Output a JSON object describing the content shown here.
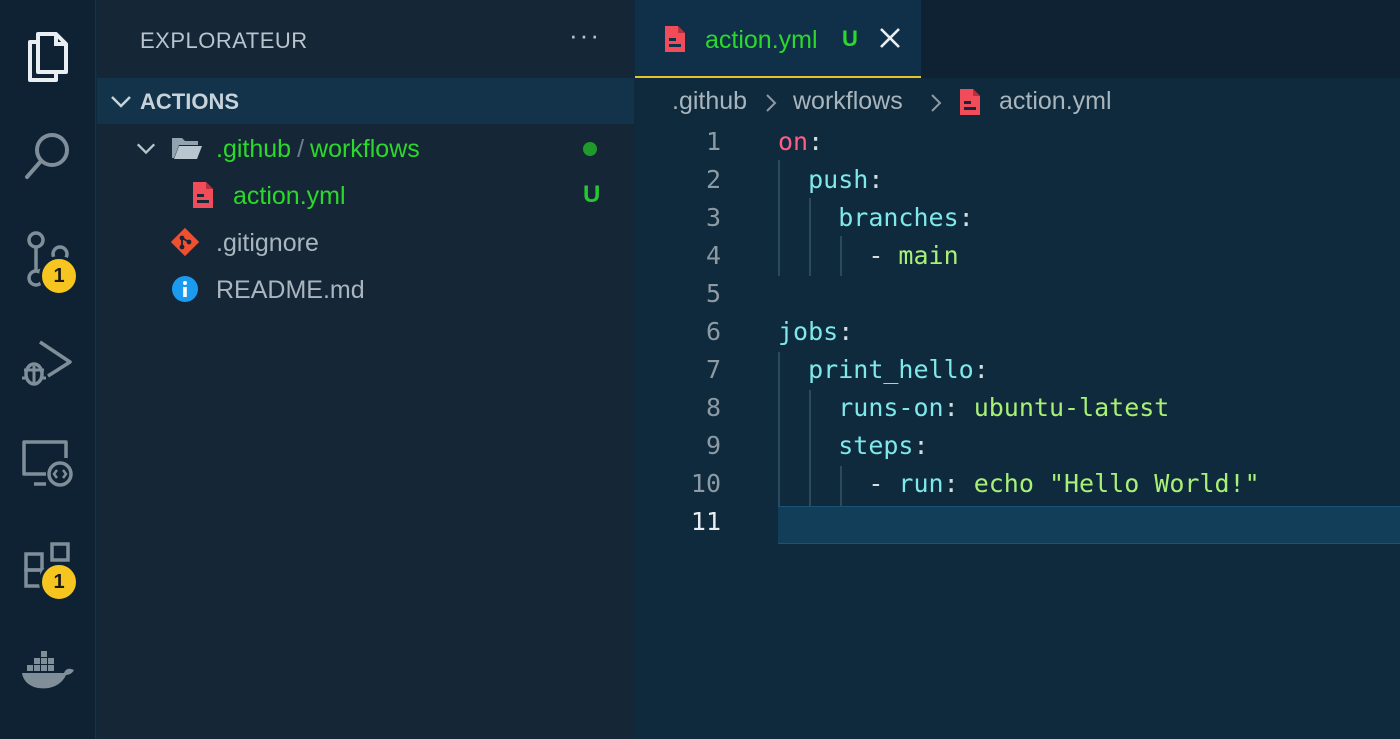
{
  "activity_bar": {
    "items": [
      {
        "icon": "explorer-icon"
      },
      {
        "icon": "search-icon"
      },
      {
        "icon": "source-control-icon",
        "badge": "1"
      },
      {
        "icon": "run-debug-icon"
      },
      {
        "icon": "remote-explorer-icon"
      },
      {
        "icon": "extensions-icon",
        "badge": "1"
      },
      {
        "icon": "docker-icon"
      }
    ]
  },
  "sidebar": {
    "title": "EXPLORATEUR",
    "more": "···",
    "section": "ACTIONS",
    "tree": [
      {
        "name_part1": ".github",
        "separator": "/",
        "name_part2": "workflows",
        "type": "folder",
        "status": "modified-dot"
      },
      {
        "name": "action.yml",
        "type": "yaml-file",
        "status": "U"
      },
      {
        "name": ".gitignore",
        "type": "git-file"
      },
      {
        "name": "README.md",
        "type": "info-file"
      }
    ]
  },
  "editor": {
    "tab": {
      "label": "action.yml",
      "status": "U"
    },
    "breadcrumbs": [
      ".github",
      "workflows",
      "action.yml"
    ],
    "lines": [
      {
        "n": "1",
        "code": "on:"
      },
      {
        "n": "2",
        "code": "  push:"
      },
      {
        "n": "3",
        "code": "    branches:"
      },
      {
        "n": "4",
        "code": "      - main"
      },
      {
        "n": "5",
        "code": ""
      },
      {
        "n": "6",
        "code": "jobs:"
      },
      {
        "n": "7",
        "code": "  print_hello:"
      },
      {
        "n": "8",
        "code": "    runs-on: ubuntu-latest"
      },
      {
        "n": "9",
        "code": "    steps:"
      },
      {
        "n": "10",
        "code": "      - run: echo \"Hello World!\""
      },
      {
        "n": "11",
        "code": ""
      }
    ],
    "tokens": {
      "l1": {
        "key": "on",
        "colon": ":"
      },
      "l2": {
        "key": "push",
        "colon": ":"
      },
      "l3": {
        "key": "branches",
        "colon": ":"
      },
      "l4": {
        "dash": "- ",
        "value": "main"
      },
      "l6": {
        "key": "jobs",
        "colon": ":"
      },
      "l7": {
        "key": "print_hello",
        "colon": ":"
      },
      "l8": {
        "key": "runs-on",
        "colon": ": ",
        "value": "ubuntu-latest"
      },
      "l9": {
        "key": "steps",
        "colon": ":"
      },
      "l10": {
        "dash": "- ",
        "key": "run",
        "colon": ": ",
        "value": "echo \"Hello World!\""
      }
    }
  },
  "colors": {
    "git_added": "#2bd92b",
    "badge": "#f7c51f",
    "yaml_icon": "#f14c5a",
    "key": "#7fe8ea",
    "string": "#a8f076",
    "keyword": "#ff5c8a"
  }
}
